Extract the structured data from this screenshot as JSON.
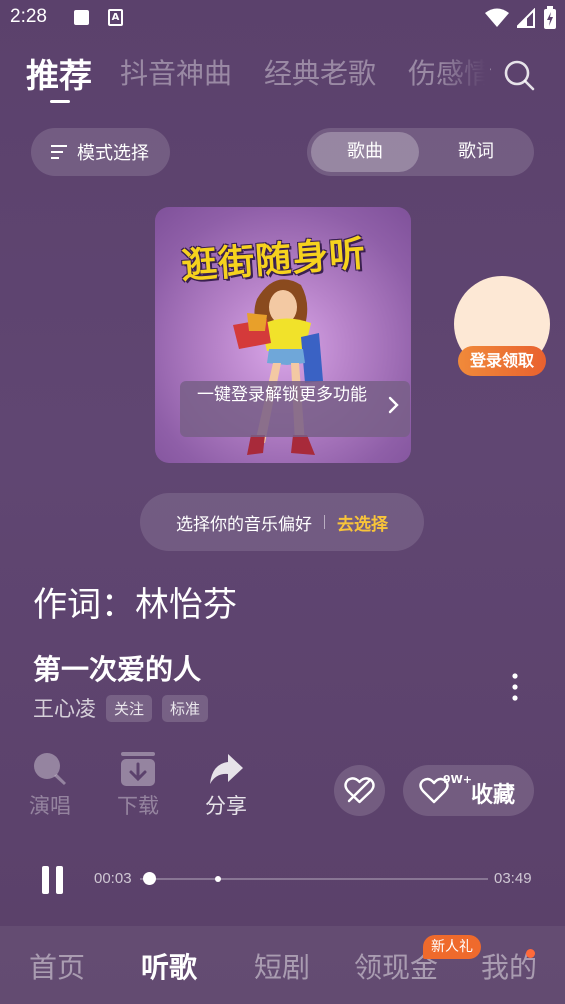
{
  "status": {
    "time": "2:28"
  },
  "tabs": [
    {
      "label": "推荐",
      "active": true
    },
    {
      "label": "抖音神曲",
      "active": false
    },
    {
      "label": "经典老歌",
      "active": false
    },
    {
      "label": "伤感情",
      "active": false
    }
  ],
  "toolbar": {
    "mode_label": "模式选择",
    "segment": {
      "song": "歌曲",
      "lyrics": "歌词"
    }
  },
  "cover": {
    "title": "逛街随身听",
    "overlay_text": "一键登录解锁更多功能"
  },
  "reward": {
    "label": "登录领取"
  },
  "preference": {
    "text": "选择你的音乐偏好",
    "action": "去选择"
  },
  "lyric_line": "作词：林怡芬",
  "song": {
    "title": "第一次爱的人",
    "artist": "王心凌",
    "follow_label": "关注",
    "quality_label": "标准"
  },
  "actions": {
    "sing": "演唱",
    "download": "下载",
    "share": "分享",
    "favorite_count": "9W+",
    "favorite": "收藏"
  },
  "player": {
    "current": "00:03",
    "duration": "03:49",
    "progress": 0.013
  },
  "bottom_nav": {
    "home": "首页",
    "listen": "听歌",
    "drama": "短剧",
    "cash": "领现金",
    "mine": "我的",
    "cash_badge": "新人礼"
  }
}
